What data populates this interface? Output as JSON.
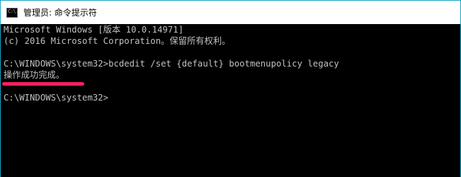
{
  "window": {
    "title": "管理员: 命令提示符",
    "icon": "cmd-icon",
    "icon_label": "C:\\."
  },
  "console": {
    "lines": [
      "Microsoft Windows [版本 10.0.14971]",
      "(c) 2016 Microsoft Corporation。保留所有权利。",
      "",
      "C:\\WINDOWS\\system32>bcdedit /set {default} bootmenupolicy legacy",
      "操作成功完成。",
      "",
      "C:\\WINDOWS\\system32>"
    ]
  },
  "colors": {
    "console_background": "#000000",
    "console_text": "#c0c0c0",
    "title_background": "#ffffff",
    "window_border": "#1aa3c9",
    "highlight_stroke": "#ff1f5a"
  }
}
